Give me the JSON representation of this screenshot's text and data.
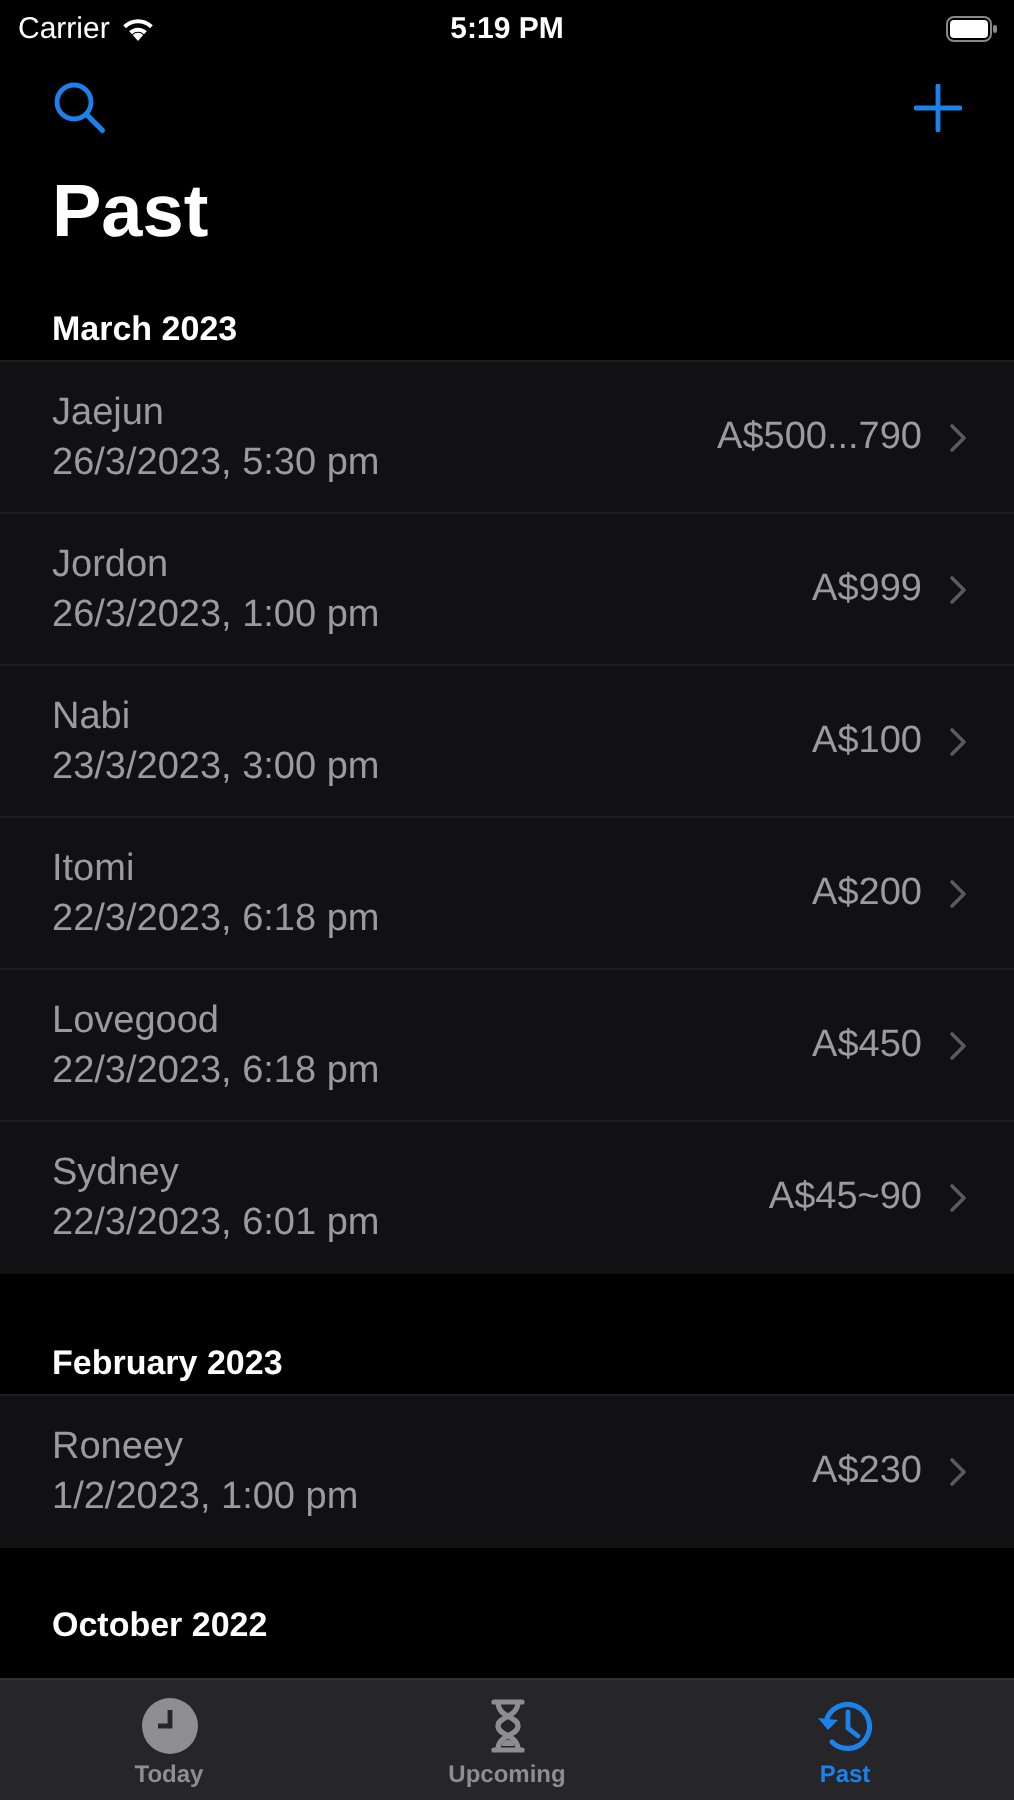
{
  "status_bar": {
    "carrier": "Carrier",
    "time": "5:19 PM"
  },
  "title": "Past",
  "sections": [
    {
      "header": "March 2023",
      "rows": [
        {
          "name": "Jaejun",
          "date": "26/3/2023, 5:30 pm",
          "amount": "A$500...790"
        },
        {
          "name": "Jordon",
          "date": "26/3/2023, 1:00 pm",
          "amount": "A$999"
        },
        {
          "name": "Nabi",
          "date": "23/3/2023, 3:00 pm",
          "amount": "A$100"
        },
        {
          "name": "Itomi",
          "date": "22/3/2023, 6:18 pm",
          "amount": "A$200"
        },
        {
          "name": "Lovegood",
          "date": "22/3/2023, 6:18 pm",
          "amount": "A$450"
        },
        {
          "name": "Sydney",
          "date": "22/3/2023, 6:01 pm",
          "amount": "A$45~90"
        }
      ]
    },
    {
      "header": "February 2023",
      "rows": [
        {
          "name": "Roneey",
          "date": "1/2/2023, 1:00 pm",
          "amount": "A$230"
        }
      ]
    },
    {
      "header": "October 2022"
    }
  ],
  "tabs": [
    {
      "label": "Today",
      "kind": "clock",
      "selected": false
    },
    {
      "label": "Upcoming",
      "kind": "hourglass",
      "selected": false
    },
    {
      "label": "Past",
      "kind": "history",
      "selected": true
    }
  ]
}
